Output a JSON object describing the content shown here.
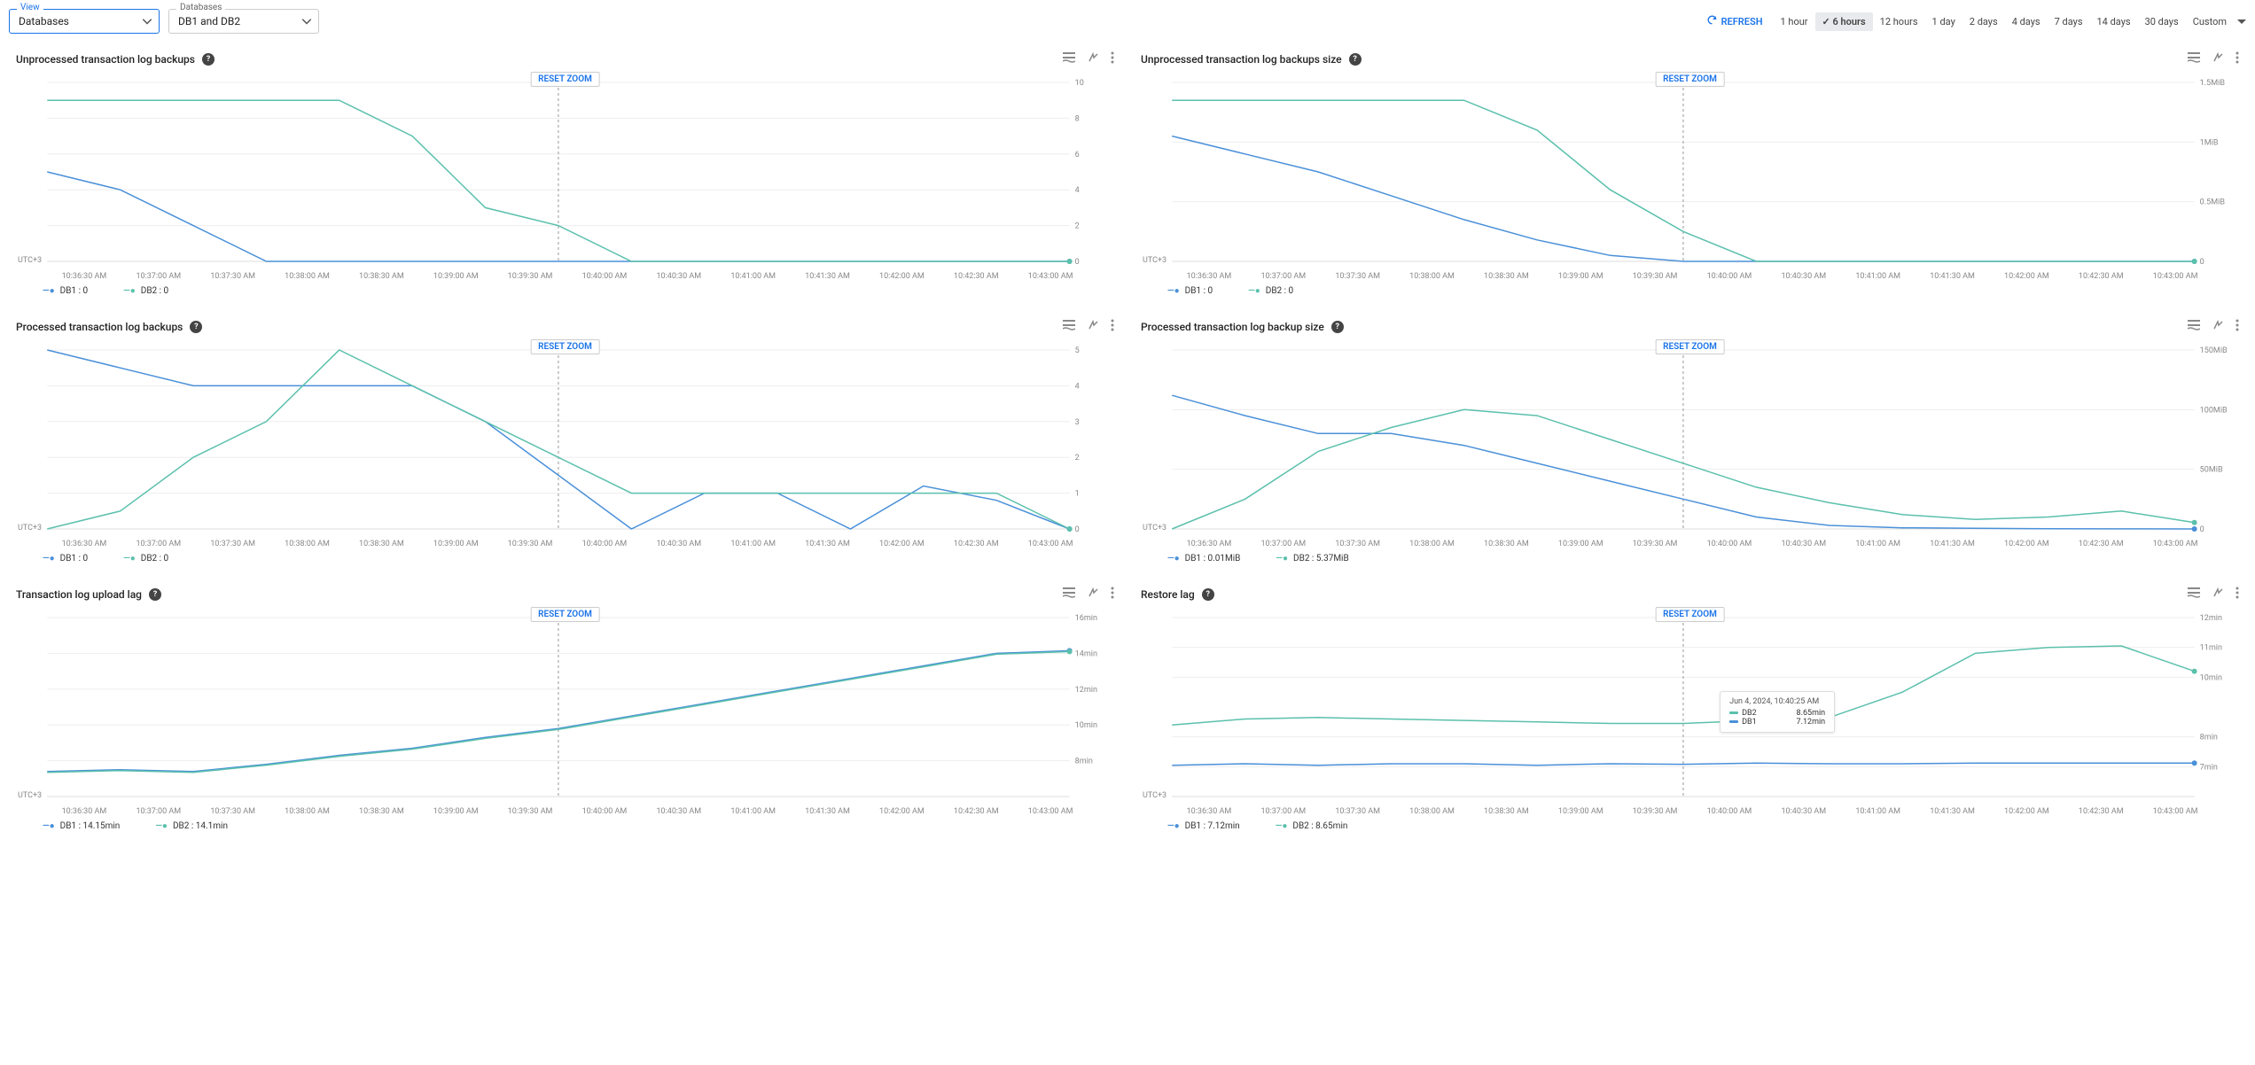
{
  "filters": {
    "view_label": "View",
    "view_value": "Databases",
    "db_label": "Databases",
    "db_value": "DB1 and DB2"
  },
  "toolbar": {
    "refresh": "REFRESH",
    "ranges": [
      "1 hour",
      "6 hours",
      "12 hours",
      "1 day",
      "2 days",
      "4 days",
      "7 days",
      "14 days",
      "30 days",
      "Custom"
    ],
    "active_range": "6 hours"
  },
  "common": {
    "reset_zoom": "RESET ZOOM",
    "utc": "UTC+3",
    "x_ticks": [
      "10:36:30 AM",
      "10:37:00 AM",
      "10:37:30 AM",
      "10:38:00 AM",
      "10:38:30 AM",
      "10:39:00 AM",
      "10:39:30 AM",
      "10:40:00 AM",
      "10:40:30 AM",
      "10:41:00 AM",
      "10:41:30 AM",
      "10:42:00 AM",
      "10:42:30 AM",
      "10:43:00 AM"
    ]
  },
  "chart_data": [
    {
      "id": "unproc_count",
      "title": "Unprocessed transaction log backups",
      "type": "line",
      "ylim": [
        0,
        10
      ],
      "y_ticks": [
        0,
        2,
        4,
        6,
        8,
        10
      ],
      "y_tick_fmt": "n",
      "zoom_x_index": 7,
      "series": [
        {
          "name": "DB1",
          "color": "db1",
          "values": [
            5,
            4,
            2,
            0,
            0,
            0,
            0,
            0,
            0,
            0,
            0,
            0,
            0,
            0,
            0
          ]
        },
        {
          "name": "DB2",
          "color": "db2",
          "values": [
            9,
            9,
            9,
            9,
            9,
            7,
            3,
            2,
            0,
            0,
            0,
            0,
            0,
            0,
            0
          ]
        }
      ],
      "legend": [
        {
          "name": "DB1",
          "value": "0"
        },
        {
          "name": "DB2",
          "value": "0"
        }
      ]
    },
    {
      "id": "unproc_size",
      "title": "Unprocessed transaction log backups size",
      "type": "line",
      "ylim": [
        0,
        1.5
      ],
      "y_ticks": [
        0,
        0.5,
        1,
        1.5
      ],
      "y_tick_labels": [
        "0",
        "0.5MiB",
        "1MiB",
        "1.5MiB"
      ],
      "zoom_x_index": 7,
      "series": [
        {
          "name": "DB1",
          "color": "db1",
          "values": [
            1.05,
            0.9,
            0.75,
            0.55,
            0.35,
            0.18,
            0.05,
            0,
            0,
            0,
            0,
            0,
            0,
            0,
            0
          ]
        },
        {
          "name": "DB2",
          "color": "db2",
          "values": [
            1.35,
            1.35,
            1.35,
            1.35,
            1.35,
            1.1,
            0.6,
            0.25,
            0,
            0,
            0,
            0,
            0,
            0,
            0
          ]
        }
      ],
      "legend": [
        {
          "name": "DB1",
          "value": "0"
        },
        {
          "name": "DB2",
          "value": "0"
        }
      ]
    },
    {
      "id": "proc_count",
      "title": "Processed transaction log backups",
      "type": "line",
      "ylim": [
        0,
        5
      ],
      "y_ticks": [
        0,
        1,
        2,
        3,
        4,
        5
      ],
      "y_tick_fmt": "n",
      "zoom_x_index": 7,
      "series": [
        {
          "name": "DB1",
          "color": "db1",
          "values": [
            5,
            4.5,
            4,
            4,
            4,
            4,
            3,
            1.5,
            0,
            1,
            1,
            0,
            1.2,
            0.8,
            0
          ]
        },
        {
          "name": "DB2",
          "color": "db2",
          "values": [
            0,
            0.5,
            2,
            3,
            5,
            4,
            3,
            2,
            1,
            1,
            1,
            1,
            1,
            1,
            0
          ]
        }
      ],
      "legend": [
        {
          "name": "DB1",
          "value": "0"
        },
        {
          "name": "DB2",
          "value": "0"
        }
      ]
    },
    {
      "id": "proc_size",
      "title": "Processed transaction log backup size",
      "type": "line",
      "ylim": [
        0,
        150
      ],
      "y_ticks": [
        0,
        50,
        100,
        150
      ],
      "y_tick_labels": [
        "0",
        "50MiB",
        "100MiB",
        "150MiB"
      ],
      "zoom_x_index": 7,
      "series": [
        {
          "name": "DB1",
          "color": "db1",
          "values": [
            112,
            95,
            80,
            80,
            70,
            55,
            40,
            25,
            10,
            3,
            1,
            0.5,
            0.2,
            0.1,
            0.01
          ]
        },
        {
          "name": "DB2",
          "color": "db2",
          "values": [
            0,
            25,
            65,
            85,
            100,
            95,
            75,
            55,
            35,
            22,
            12,
            8,
            10,
            15,
            5.37
          ]
        }
      ],
      "legend": [
        {
          "name": "DB1",
          "value": "0.01MiB"
        },
        {
          "name": "DB2",
          "value": "5.37MiB"
        }
      ]
    },
    {
      "id": "upload_lag",
      "title": "Transaction log upload lag",
      "type": "line",
      "ylim": [
        6,
        16
      ],
      "y_ticks": [
        8,
        10,
        12,
        14,
        16
      ],
      "y_tick_labels": [
        "8min",
        "10min",
        "12min",
        "14min",
        "16min"
      ],
      "zoom_x_index": 7,
      "series": [
        {
          "name": "DB1",
          "color": "db1",
          "values": [
            7.4,
            7.5,
            7.4,
            7.8,
            8.3,
            8.7,
            9.3,
            9.8,
            10.5,
            11.2,
            11.9,
            12.6,
            13.3,
            14.0,
            14.15
          ]
        },
        {
          "name": "DB2",
          "color": "db2",
          "values": [
            7.35,
            7.45,
            7.35,
            7.75,
            8.25,
            8.65,
            9.25,
            9.75,
            10.45,
            11.15,
            11.85,
            12.55,
            13.25,
            13.95,
            14.1
          ]
        }
      ],
      "legend": [
        {
          "name": "DB1",
          "value": "14.15min"
        },
        {
          "name": "DB2",
          "value": "14.1min"
        }
      ]
    },
    {
      "id": "restore_lag",
      "title": "Restore lag",
      "type": "line",
      "ylim": [
        6,
        12
      ],
      "y_ticks": [
        7,
        8,
        10,
        11,
        12
      ],
      "y_tick_labels": [
        "7min",
        "8min",
        "10min",
        "11min",
        "12min"
      ],
      "zoom_x_index": 7,
      "tooltip": {
        "time": "Jun 4, 2024, 10:40:25 AM",
        "rows": [
          {
            "name": "DB2",
            "value": "8.65min",
            "color": "db2"
          },
          {
            "name": "DB1",
            "value": "7.12min",
            "color": "db1"
          }
        ],
        "pos_x_index": 7.5
      },
      "series": [
        {
          "name": "DB1",
          "color": "db1",
          "values": [
            7.05,
            7.1,
            7.05,
            7.1,
            7.1,
            7.05,
            7.1,
            7.08,
            7.12,
            7.1,
            7.1,
            7.12,
            7.12,
            7.12,
            7.12
          ]
        },
        {
          "name": "DB2",
          "color": "db2",
          "values": [
            8.4,
            8.6,
            8.65,
            8.6,
            8.55,
            8.5,
            8.45,
            8.45,
            8.55,
            8.65,
            9.5,
            10.8,
            11.0,
            11.05,
            10.2
          ]
        }
      ],
      "legend": [
        {
          "name": "DB1",
          "value": "7.12min"
        },
        {
          "name": "DB2",
          "value": "8.65min"
        }
      ]
    }
  ]
}
